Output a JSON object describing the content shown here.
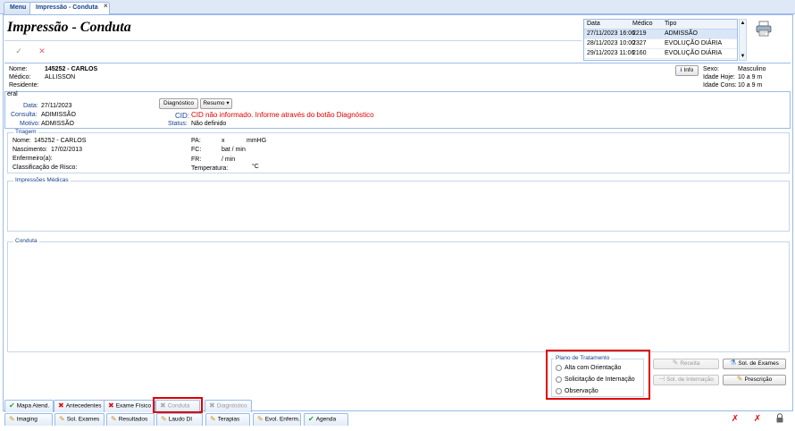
{
  "tabs": [
    {
      "label": "Menu"
    },
    {
      "label": "Impressão - Conduta"
    }
  ],
  "title": "Impressão - Conduta",
  "history": {
    "headers": [
      "Data",
      "Médico",
      "Tipo"
    ],
    "rows": [
      {
        "date": "27/11/2023 16:06",
        "doctor": "2219",
        "type": "ADMISSÃO"
      },
      {
        "date": "28/11/2023 10:00",
        "doctor": "2327",
        "type": "EVOLUÇÃO DIÁRIA"
      },
      {
        "date": "29/11/2023 11:06",
        "doctor": "2160",
        "type": "EVOLUÇÃO DIÁRIA"
      }
    ]
  },
  "patient": {
    "nome_label": "Nome:",
    "nome": "145252 - CARLOS",
    "medico_label": "Médico:",
    "medico": "ALLISSON",
    "residente_label": "Residente:",
    "residente": ""
  },
  "info_button": "Info",
  "right_info": {
    "sexo_label": "Sexo:",
    "sexo": "Masculino",
    "idade_hoje_label": "Idade Hoje:",
    "idade_hoje": "10 a 9 m",
    "idade_cons_label": "Idade Cons:",
    "idade_cons": "10 a 9 m"
  },
  "geral": {
    "legend": "eral",
    "data_label": "Data:",
    "data": "27/11/2023",
    "consulta_label": "Consulta:",
    "consulta": "ADIMISSÃO",
    "motivo_label": "Motivo:",
    "motivo": "ADMISSÃO",
    "diagnostico_btn": "Diagnóstico",
    "resumo_btn": "Resumo",
    "cid_label": "CID:",
    "cid_text": "CID não informado. Informe através do botão Diagnóstico",
    "status_label": "Status:",
    "status": "Não definido"
  },
  "triagem": {
    "legend": "Triagem",
    "nome_label": "Nome:",
    "nome": "145252 - CARLOS",
    "nascimento_label": "Nascimento:",
    "nascimento": "17/02/2013",
    "enfermeiro_label": "Enfermeiro(a):",
    "enfermeiro": "",
    "classificacao_label": "Classificação de Risco:",
    "classificacao": "",
    "pa_label": "PA:",
    "pa_sep": "x",
    "pa_unit": "mmHG",
    "fc_label": "FC:",
    "fc_unit": "bat / min",
    "fr_label": "FR:",
    "fr_unit": "/ min",
    "temp_label": "Temperatura:",
    "temp_unit": "°C"
  },
  "impressoes": {
    "legend": "Impressões Médicas"
  },
  "conduta": {
    "legend": "Conduta"
  },
  "plano": {
    "legend": "Plano de Tratamento",
    "options": [
      "Alta com Orientação",
      "Solicitação de Internação",
      "Observação"
    ]
  },
  "side_buttons": {
    "receita": "Receita",
    "sol_exames": "Sol. de Exames",
    "sol_internacao": "Sol. de Internação",
    "prescricao": "Prescrição"
  },
  "bottom_tabs_row1": [
    {
      "label": "Mapa Atend."
    },
    {
      "label": "Antecedentes"
    },
    {
      "label": "Exame Físico"
    },
    {
      "label": "Conduta"
    },
    {
      "label": "Diagnóstico"
    }
  ],
  "bottom_tabs_row2": [
    {
      "label": "Imaging"
    },
    {
      "label": "Sol. Exames"
    },
    {
      "label": "Resultados"
    },
    {
      "label": "Laudo DI"
    },
    {
      "label": "Terapias"
    },
    {
      "label": "Evol. Enferm."
    },
    {
      "label": "Agenda"
    }
  ],
  "colors": {
    "accent": "#15428b",
    "border": "#99bbe8",
    "highlight": "#e00000"
  }
}
